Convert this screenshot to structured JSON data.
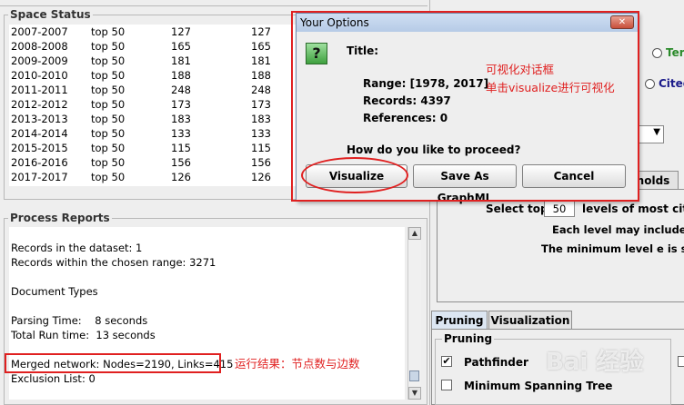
{
  "space_status": {
    "title": "Space Status",
    "rows": [
      [
        "2007-2007",
        "top 50",
        "127",
        "127"
      ],
      [
        "2008-2008",
        "top 50",
        "165",
        "165"
      ],
      [
        "2009-2009",
        "top 50",
        "181",
        "181"
      ],
      [
        "2010-2010",
        "top 50",
        "188",
        "188"
      ],
      [
        "2011-2011",
        "top 50",
        "248",
        "248"
      ],
      [
        "2012-2012",
        "top 50",
        "173",
        "173"
      ],
      [
        "2013-2013",
        "top 50",
        "183",
        "183"
      ],
      [
        "2014-2014",
        "top 50",
        "133",
        "133"
      ],
      [
        "2015-2015",
        "top 50",
        "115",
        "115"
      ],
      [
        "2016-2016",
        "top 50",
        "156",
        "156"
      ],
      [
        "2017-2017",
        "top 50",
        "126",
        "126"
      ]
    ]
  },
  "process_reports": {
    "title": "Process Reports",
    "records_dataset": "Records in the dataset: 1",
    "records_range": "Records within the chosen range: 3271",
    "doc_types": "Document Types",
    "parsing_time": "Parsing Time:    8 seconds",
    "total_run_time": "Total Run time:  13 seconds",
    "merged_network": "Merged network: Nodes=2190, Links=415",
    "exclusion_list": "Exclusion List: 0",
    "annotation": "运行结果：节点数与边数"
  },
  "dialog": {
    "title": "Your Options",
    "close_glyph": "✕",
    "question_glyph": "?",
    "title_label": "Title:",
    "range": "Range: [1978, 2017]",
    "records": "Records: 4397",
    "references": "References: 0",
    "prompt": "How do you like to proceed?",
    "visualize": "Visualize",
    "save_graphml": "Save As GraphML",
    "cancel": "Cancel",
    "annotation_line1": "可视化对话框",
    "annotation_line2": "单击visualize进行可视化"
  },
  "right_panel": {
    "radio_ter": "Ter",
    "radio_cited": "Cited",
    "tab_holds": "holds",
    "select_top": "Select top",
    "select_top_value": "50",
    "levels_text": "levels of most cited",
    "each_level": "Each level may include mu",
    "minimum_level": "The minimum level e is set i",
    "tab_pruning": "Pruning",
    "tab_visualization": "Visualization",
    "pruning_group": "Pruning",
    "pathfinder": "Pathfinder",
    "pathfinder_checked": true,
    "mst": "Minimum Spanning Tree",
    "mst_checked": false
  },
  "watermark": "Bai 经验"
}
